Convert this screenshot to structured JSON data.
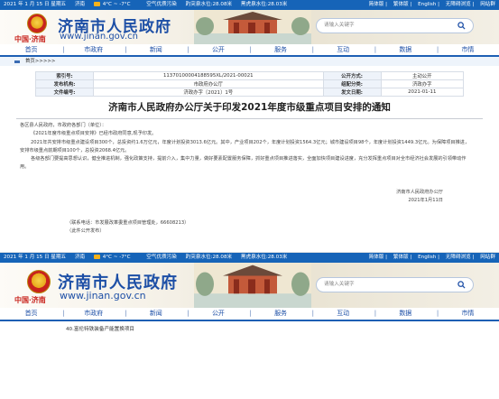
{
  "top_bar": {
    "date": "2021 年 1 月 15 日 星期五",
    "weather_city": "济南",
    "temperature": "4°C ~ -7°C",
    "air": "空气优质污染",
    "water1": "趵突泉水位:28.08米",
    "water2": "黑虎泉水位:28.03米",
    "links": [
      "简体版",
      "繁体版",
      "English",
      "无障碍浏览",
      "网站群"
    ]
  },
  "header": {
    "logo_text": "中国·济南",
    "site_title": "济南市人民政府",
    "site_url": "www.jinan.gov.cn",
    "search_placeholder": "请输入关键字"
  },
  "nav": {
    "items": [
      "首页",
      "市政府",
      "新闻",
      "公开",
      "服务",
      "互动",
      "数据",
      "市情"
    ]
  },
  "breadcrumb": "首页>>>>>",
  "meta": {
    "index_label": "索引号:",
    "index_value": "11370100004188595XL/2021-00021",
    "method_label": "公开方式:",
    "method_value": "主动公开",
    "org_label": "发布机构:",
    "org_value": "市政府办公厅",
    "category_label": "组配分类:",
    "category_value": "济政办字",
    "docno_label": "文件编号:",
    "docno_value": "济政办字〔2021〕1号",
    "date_label": "发文日期:",
    "date_value": "2021-01-11"
  },
  "doc": {
    "title": "济南市人民政府办公厅关于印发2021年度市级重点项目安排的通知",
    "salutation": "各区县人民政府，市政府各部门（单位）：",
    "p1": "《2021年度市级重点项目安排》已经市政府同意,现予印发。",
    "p2": "2021年共安排市级重点建设项目300个，总投资约1.6万亿元，年度计划投资3013.6亿元。其中，产业项目202个，年度计划投资1564.3亿元；城市建设项目98个，年度计划投资1449.3亿元。为保障项目推进，安排市级重点前期项目100个，总投资2068.4亿元。",
    "p3": "各级各部门要提高思想认识，健全推进机制，强化政策支持，提前介入，集中力量，做好要素配置服务保障，抓好重点项目推进落实，全面加快项目建设进度，充分发挥重点项目对全市经济社会发展的引领带动作用。",
    "signer": "济南市人民政府办公厅",
    "sign_date": "2021年1月11日",
    "contact": "（联系电话：市发展改革委重点项目管理处，66608213）",
    "public_note": "（此件公开发布）"
  },
  "list_item": "40.富伦特铁装备产能置换项目",
  "colors": {
    "accent_blue": "#1d4fa6",
    "topbar_blue": "#1664b8",
    "logo_red": "#c8231d"
  }
}
